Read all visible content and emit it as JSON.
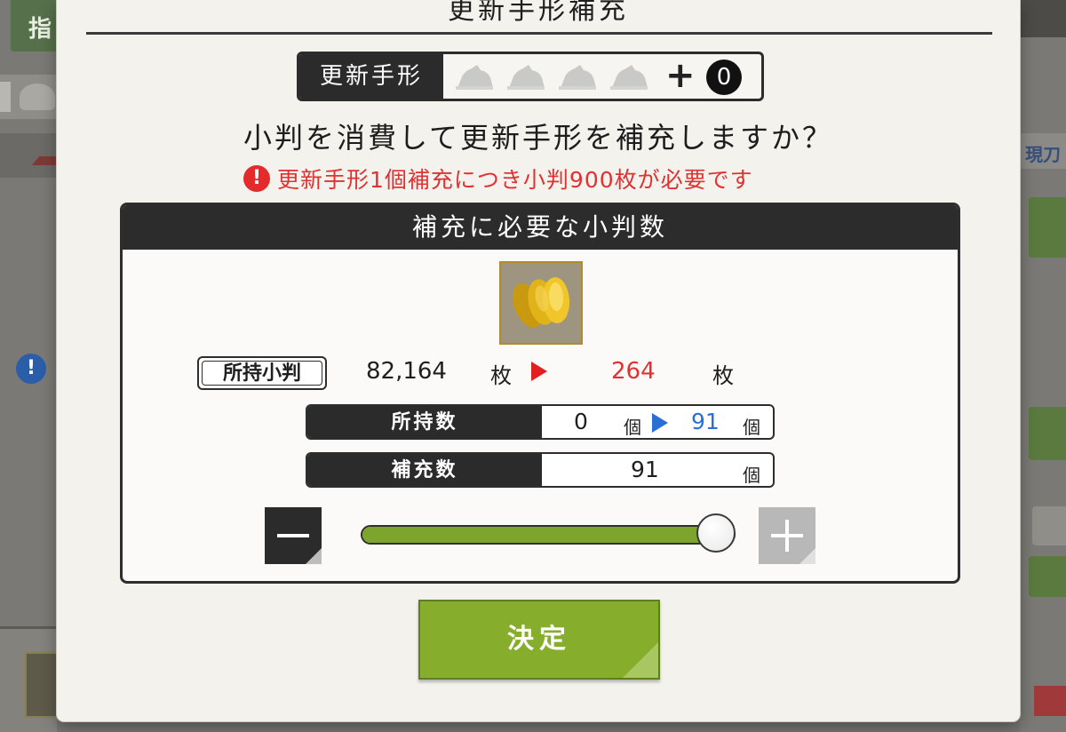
{
  "dialog": {
    "title": "更新手形補充",
    "coupon": {
      "label": "更新手形",
      "slots_count": 4,
      "plus": "+",
      "count": "0"
    },
    "question": "小判を消費して更新手形を補充しますか？",
    "warning": {
      "icon": "!",
      "text": "更新手形1個補充につき小判900枚が必要です"
    },
    "panel": {
      "header": "補充に必要な小判数",
      "item_icon": "koban-coins-icon",
      "owned_koban_label": "所持小判",
      "koban_before": "82,164",
      "koban_unit": "枚",
      "koban_after": "264",
      "rows": {
        "owned": {
          "label": "所持数",
          "before": "0",
          "after": "91",
          "unit": "個"
        },
        "refill": {
          "label": "補充数",
          "value": "91",
          "unit": "個"
        }
      },
      "slider": {
        "level": 1.0,
        "fill_color": "#7da52b"
      }
    },
    "confirm_label": "決定"
  },
  "background": {
    "left_tab": "指",
    "right_label": "現刀"
  },
  "colors": {
    "accent_green": "#86ad2c",
    "warning_red": "#e13131",
    "blue": "#2a6fd6",
    "dark": "#2b2b2b"
  }
}
